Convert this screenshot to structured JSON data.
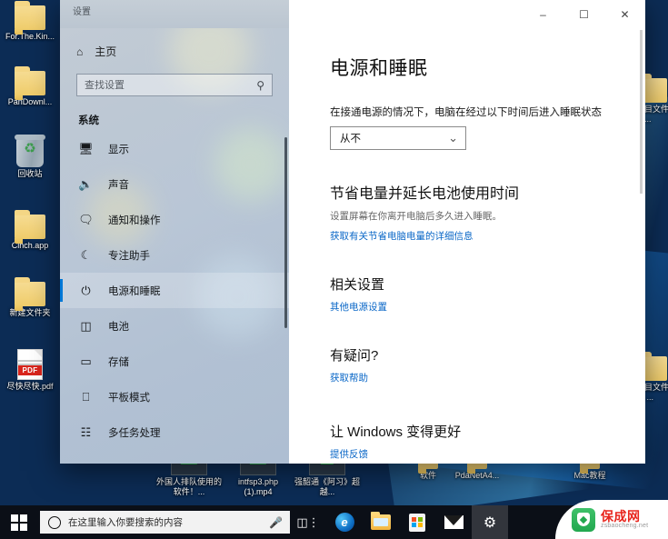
{
  "desktop": {
    "icons_left": [
      {
        "label": "For.The.Kin...",
        "type": "folder"
      },
      {
        "label": "PanDownl...",
        "type": "folder"
      },
      {
        "label": "回收站",
        "type": "recycle-bin"
      },
      {
        "label": "Cinch.app",
        "type": "folder"
      },
      {
        "label": "新建文件夹",
        "type": "folder"
      },
      {
        "label": "尽快尽快.pdf",
        "type": "pdf"
      }
    ],
    "icons_bottom": [
      {
        "label": "外国人排队使用的软件！...",
        "type": "video",
        "badge": "mp4"
      },
      {
        "label": "intfsp3.php (1).mp4",
        "type": "video",
        "badge": "mp4"
      },
      {
        "label": "强韶通《阿习》超越...",
        "type": "video",
        "badge": "avi"
      },
      {
        "label": "软件",
        "type": "folder"
      },
      {
        "label": "PdaNetA4...",
        "type": "folder"
      },
      {
        "label": "Mac教程",
        "type": "folder"
      }
    ],
    "icons_right": [
      {
        "label": "项目文件夹...",
        "type": "folder"
      },
      {
        "label": "项目文件夹 ...",
        "type": "folder"
      }
    ]
  },
  "window": {
    "title": "设置",
    "minimize_label": "–",
    "maximize_label": "☐",
    "close_label": "✕"
  },
  "sidebar": {
    "home_label": "主页",
    "home_icon": "home-icon",
    "search": {
      "placeholder": "查找设置",
      "value": "",
      "icon": "search-icon"
    },
    "group_header": "系统",
    "items": [
      {
        "label": "显示",
        "icon": "monitor-icon",
        "selected": false
      },
      {
        "label": "声音",
        "icon": "speaker-icon",
        "selected": false
      },
      {
        "label": "通知和操作",
        "icon": "notification-icon",
        "selected": false
      },
      {
        "label": "专注助手",
        "icon": "moon-icon",
        "selected": false
      },
      {
        "label": "电源和睡眠",
        "icon": "power-icon",
        "selected": true
      },
      {
        "label": "电池",
        "icon": "battery-icon",
        "selected": false
      },
      {
        "label": "存储",
        "icon": "storage-icon",
        "selected": false
      },
      {
        "label": "平板模式",
        "icon": "tablet-icon",
        "selected": false
      },
      {
        "label": "多任务处理",
        "icon": "multitask-icon",
        "selected": false
      }
    ]
  },
  "content": {
    "page_title": "电源和睡眠",
    "sleep_label": "在接通电源的情况下，电脑在经过以下时间后进入睡眠状态",
    "sleep_value": "从不",
    "sleep_chevron": "⌄",
    "battery_heading": "节省电量并延长电池使用时间",
    "battery_sub": "设置屏幕在你离开电脑后多久进入睡眠。",
    "battery_link": "获取有关节省电脑电量的详细信息",
    "related_heading": "相关设置",
    "related_link": "其他电源设置",
    "question_heading": "有疑问?",
    "question_link": "获取帮助",
    "feedback_heading": "让 Windows 变得更好",
    "feedback_link": "提供反馈",
    "annotation_color": "#e38b32"
  },
  "taskbar": {
    "start_label": "start-button",
    "search_placeholder": "在这里输入你要搜索的内容",
    "search_value": "",
    "mic_icon": "⮍",
    "buttons": [
      {
        "name": "task-view-button",
        "icon": "task-view-icon"
      },
      {
        "name": "edge-button",
        "icon": "edge-icon",
        "glyph": "e"
      },
      {
        "name": "file-explorer-button",
        "icon": "folder-icon"
      },
      {
        "name": "microsoft-store-button",
        "icon": "store-icon"
      },
      {
        "name": "mail-button",
        "icon": "mail-icon"
      },
      {
        "name": "settings-button",
        "icon": "gear-icon",
        "glyph": "⚙"
      }
    ]
  },
  "watermark": {
    "name": "保成网",
    "url": "zsbaocheng.net",
    "color": "#e8251d"
  }
}
